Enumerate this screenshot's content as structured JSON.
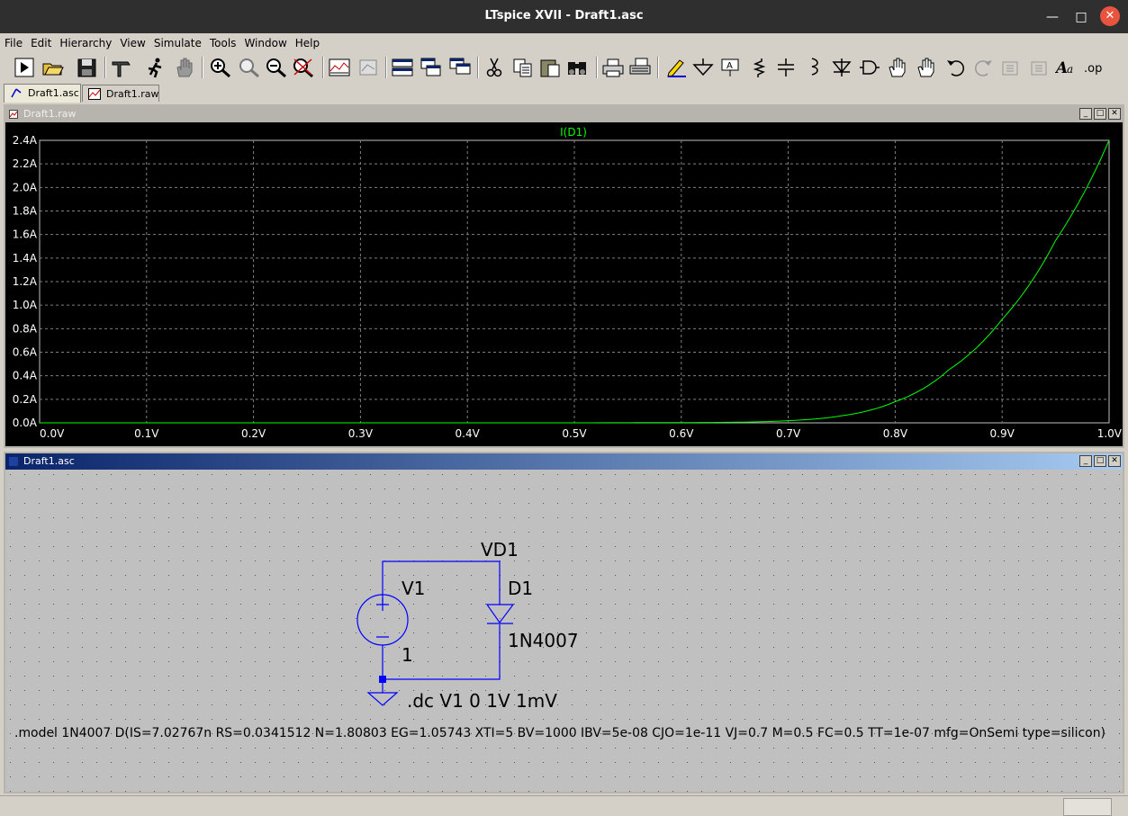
{
  "window": {
    "title": "LTspice XVII - Draft1.asc"
  },
  "menu": [
    "File",
    "Edit",
    "Hierarchy",
    "View",
    "Simulate",
    "Tools",
    "Window",
    "Help"
  ],
  "toolbar": [
    "run-icon",
    "open-icon",
    "save-icon",
    "control-panel-icon",
    "halt-icon",
    "hand-icon",
    "zoom-in-icon",
    "zoom-area-icon",
    "zoom-out-icon",
    "zoom-fit-icon",
    "autoscale-icon",
    "plot-settings-icon",
    "tile-horizontal-icon",
    "cascade-icon",
    "tile-vertical-icon",
    "cut-icon",
    "copy-icon",
    "paste-icon",
    "find-icon",
    "print-icon",
    "print-setup-icon",
    "wire-icon",
    "ground-icon",
    "label-net-icon",
    "resistor-icon",
    "capacitor-icon",
    "inductor-icon",
    "diode-icon",
    "component-icon",
    "move-icon",
    "drag-icon",
    "undo-icon",
    "redo-icon",
    "rotate-icon",
    "mirror-icon",
    "text-icon",
    "spice-directive-icon"
  ],
  "tabs": [
    {
      "label": "Draft1.asc"
    },
    {
      "label": "Draft1.raw"
    }
  ],
  "plot_window": {
    "title": "Draft1.raw"
  },
  "schematic_window": {
    "title": "Draft1.asc"
  },
  "chart_data": {
    "type": "line",
    "series": [
      {
        "name": "I(D1)",
        "color": "#00ff00",
        "x": [
          0.0,
          0.1,
          0.2,
          0.3,
          0.4,
          0.5,
          0.6,
          0.65,
          0.7,
          0.75,
          0.8,
          0.85,
          0.9,
          0.95,
          1.0
        ],
        "y": [
          0,
          0,
          0,
          0,
          0,
          0,
          0.002,
          0.005,
          0.018,
          0.06,
          0.18,
          0.45,
          0.88,
          1.55,
          2.4
        ]
      }
    ],
    "xlabel": "",
    "ylabel": "",
    "xlim": [
      0,
      1.0
    ],
    "ylim": [
      0,
      2.4
    ],
    "xticks": [
      "0.0V",
      "0.1V",
      "0.2V",
      "0.3V",
      "0.4V",
      "0.5V",
      "0.6V",
      "0.7V",
      "0.8V",
      "0.9V",
      "1.0V"
    ],
    "yticks": [
      "0.0A",
      "0.2A",
      "0.4A",
      "0.6A",
      "0.8A",
      "1.0A",
      "1.2A",
      "1.4A",
      "1.6A",
      "1.8A",
      "2.0A",
      "2.2A",
      "2.4A"
    ],
    "grid": true
  },
  "schematic": {
    "net_label": "VD1",
    "source_name": "V1",
    "source_value": "1",
    "diode_name": "D1",
    "diode_model": "1N4007",
    "dc_directive": ".dc V1 0 1V 1mV",
    "model_directive": ".model 1N4007 D(IS=7.02767n RS=0.0341512 N=1.80803 EG=1.05743 XTI=5 BV=1000 IBV=5e-08 CJO=1e-11 VJ=0.7 M=0.5 FC=0.5 TT=1e-07 mfg=OnSemi type=silicon)"
  },
  "colors": {
    "plot_bg": "#000000",
    "trace": "#00ff00",
    "grid": "#808080",
    "schem_bg": "#c0c0c0",
    "wire": "#0000ff"
  }
}
